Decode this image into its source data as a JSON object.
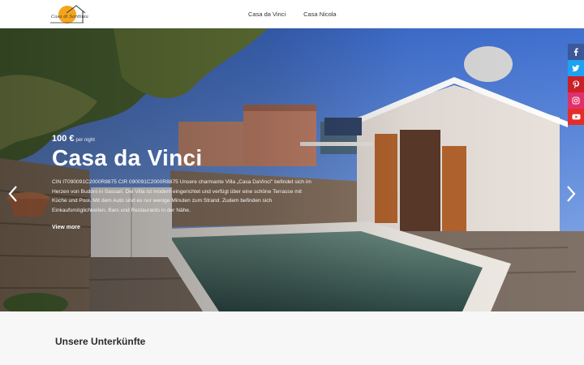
{
  "header": {
    "logo_text": "Casa di Sardinia",
    "nav": [
      "Casa da Vinci",
      "Casa Nicola"
    ]
  },
  "hero": {
    "price": "100 €",
    "price_unit": "per night",
    "title": "Casa da Vinci",
    "description": "CIN IT090091C2000R8875 CIR 090091C2000R8875 Unsere charmante Villa „Casa DaVinci\" befindet sich im Herzen von Budoni in Sassari. Die Villa ist modern eingerichtet und verfügt über eine schöne Terrasse mit Küche und Pool. Mit dem Auto sind es nur wenige Minuten zum Strand. Zudem befinden sich Einkaufsmöglichkeiten, Bars und Restaurants in der Nähe.",
    "view_more": "View more"
  },
  "social": [
    "facebook-icon",
    "twitter-icon",
    "pinterest-icon",
    "instagram-icon",
    "youtube-icon"
  ],
  "section": {
    "title": "Unsere Unterkünfte"
  },
  "colors": {
    "accent": "#f4a51c",
    "facebook": "#3b5998",
    "twitter": "#1da1f2",
    "pinterest": "#cb2027",
    "instagram": "#e1306c",
    "youtube": "#e52d27"
  }
}
